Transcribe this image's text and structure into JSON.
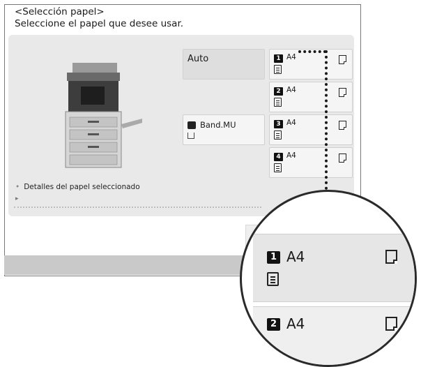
{
  "header": {
    "title": "<Selección papel>",
    "subtitle": "Seleccione el papel que desee usar."
  },
  "auto_button": {
    "label": "Auto"
  },
  "bypass_button": {
    "label": "Band.MU",
    "icon": "bypass-tray-icon"
  },
  "drawers": [
    {
      "number": "1",
      "size": "A4"
    },
    {
      "number": "2",
      "size": "A4"
    },
    {
      "number": "3",
      "size": "A4"
    },
    {
      "number": "4",
      "size": "A4"
    }
  ],
  "details": {
    "label": "Detalles del papel seleccionado",
    "arrow": "▸"
  },
  "magnifier": {
    "rows": [
      {
        "number": "1",
        "size": "A4"
      },
      {
        "number": "2",
        "size": "A4"
      }
    ]
  },
  "colors": {
    "panel": "#e9e9e9",
    "selected": "#dedede",
    "status_bar": "#c9c9c9"
  }
}
